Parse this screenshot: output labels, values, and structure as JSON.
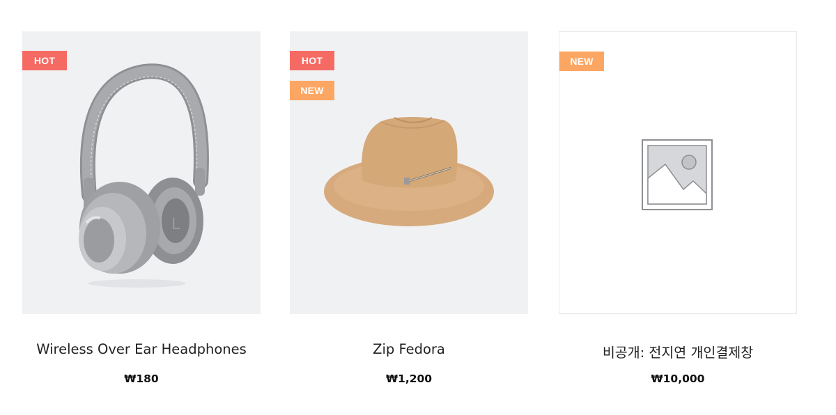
{
  "products": [
    {
      "title": "Wireless Over Ear Headphones",
      "price": "₩180",
      "badges": [
        "HOT"
      ],
      "image_icon": "headphones-image"
    },
    {
      "title": "Zip Fedora",
      "price": "₩1,200",
      "badges": [
        "HOT",
        "NEW"
      ],
      "image_icon": "fedora-hat-image"
    },
    {
      "title": "비공개: 전지연 개인결제창",
      "price": "₩10,000",
      "badges": [
        "NEW"
      ],
      "image_icon": "image-placeholder-icon"
    }
  ],
  "colors": {
    "hot_badge": "#f66a64",
    "new_badge": "#fca664",
    "thumb_bg": "#f0f1f3"
  }
}
